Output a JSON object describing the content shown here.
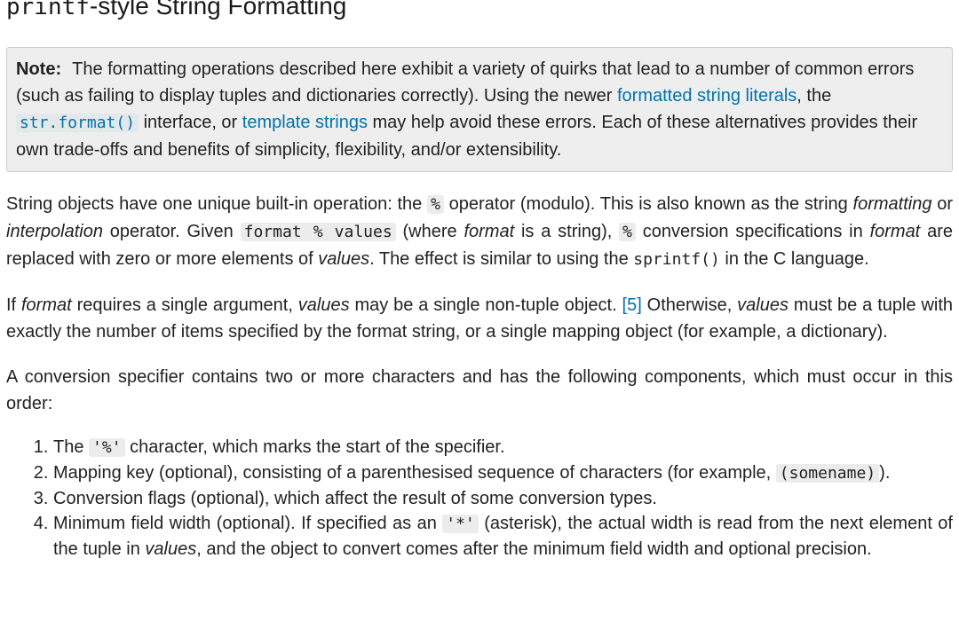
{
  "heading": {
    "code": "printf",
    "rest": "-style String Formatting"
  },
  "note": {
    "title": "Note:",
    "text1": "The formatting operations described here exhibit a variety of quirks that lead to a number of common errors (such as failing to display tuples and dictionaries correctly). Using the newer ",
    "link1": "formatted string literals",
    "text2": ", the ",
    "link2_code": "str.format()",
    "text3": " interface, or ",
    "link3": "template strings",
    "text4": " may help avoid these errors. Each of these alternatives provides their own trade-offs and benefits of simplicity, flexibility, and/or extensibility."
  },
  "para1": {
    "t1": "String objects have one unique built-in operation: the ",
    "c1": "%",
    "t2": " operator (modulo). This is also known as the string ",
    "e1": "formatting",
    "t3": " or ",
    "e2": "interpolation",
    "t4": " operator. Given ",
    "c2": "format % values",
    "t5": " (where ",
    "e3": "format",
    "t6": " is a string), ",
    "c3": "%",
    "t7": " conversion specifications in ",
    "e4": "format",
    "t8": " are replaced with zero or more elements of ",
    "e5": "values",
    "t9": ". The effect is similar to using the ",
    "c4": "sprintf()",
    "t10": " in the C language."
  },
  "para2": {
    "t1": "If ",
    "e1": "format",
    "t2": " requires a single argument, ",
    "e2": "values",
    "t3": " may be a single non-tuple object. ",
    "link": "[5]",
    "t4": " Otherwise, ",
    "e3": "values",
    "t5": " must be a tuple with exactly the number of items specified by the format string, or a single mapping object (for example, a dictionary)."
  },
  "para3": {
    "text": "A conversion specifier contains two or more characters and has the following components, which must occur in this order:"
  },
  "list": {
    "item1": {
      "t1": "The ",
      "c1": "'%'",
      "t2": " character, which marks the start of the specifier."
    },
    "item2": {
      "t1": "Mapping key (optional), consisting of a parenthesised sequence of characters (for example, ",
      "c1": "(somename)",
      "t2": ")."
    },
    "item3": {
      "t1": "Conversion flags (optional), which affect the result of some conversion types."
    },
    "item4": {
      "t1": "Minimum field width (optional). If specified as an ",
      "c1": "'*'",
      "t2": " (asterisk), the actual width is read from the next element of the tuple in ",
      "e1": "values",
      "t3": ", and the object to convert comes after the minimum field width and optional precision."
    }
  }
}
